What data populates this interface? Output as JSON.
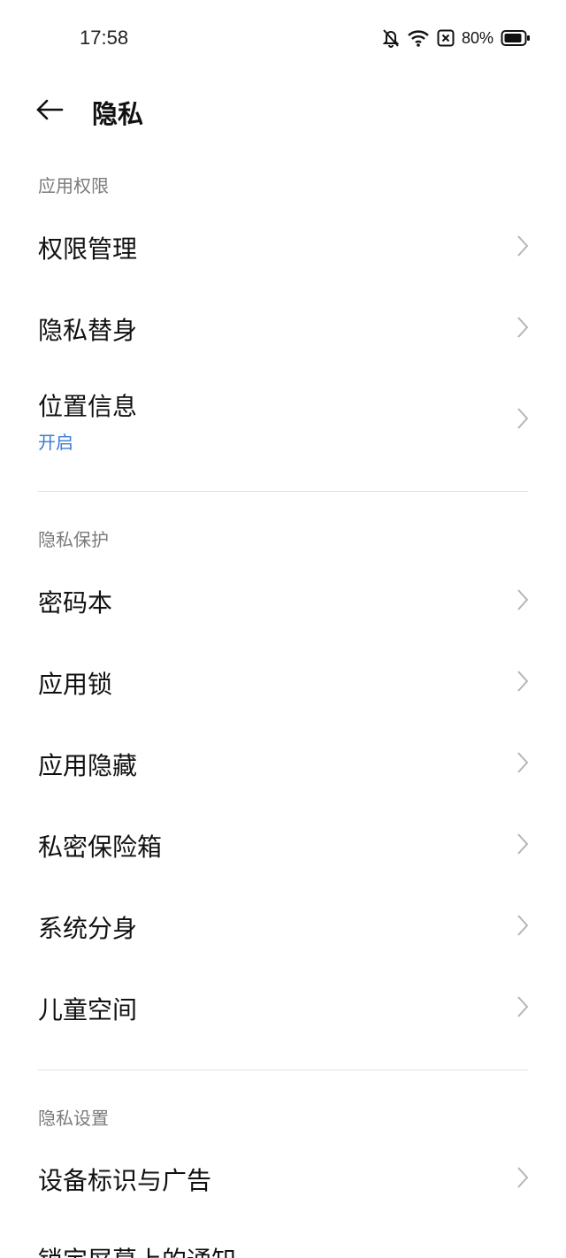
{
  "status_bar": {
    "time": "17:58",
    "battery": "80%",
    "icons": [
      "bell-off-icon",
      "wifi-icon",
      "close-box-icon",
      "battery-icon"
    ]
  },
  "header": {
    "back_icon": "arrow-left-icon",
    "title": "隐私"
  },
  "sections": [
    {
      "header": "应用权限",
      "items": [
        {
          "label": "权限管理"
        },
        {
          "label": "隐私替身"
        },
        {
          "label": "位置信息",
          "sub": "开启"
        }
      ]
    },
    {
      "header": "隐私保护",
      "items": [
        {
          "label": "密码本"
        },
        {
          "label": "应用锁"
        },
        {
          "label": "应用隐藏"
        },
        {
          "label": "私密保险箱"
        },
        {
          "label": "系统分身"
        },
        {
          "label": "儿童空间"
        }
      ]
    },
    {
      "header": "隐私设置",
      "items": [
        {
          "label": "设备标识与广告"
        },
        {
          "label": "锁定屏幕上的通知"
        }
      ]
    }
  ],
  "colors": {
    "accent": "#3a7bd5",
    "section_header": "#7b7b7b",
    "divider": "#e3e3e3",
    "chevron": "#b5b5b5"
  }
}
